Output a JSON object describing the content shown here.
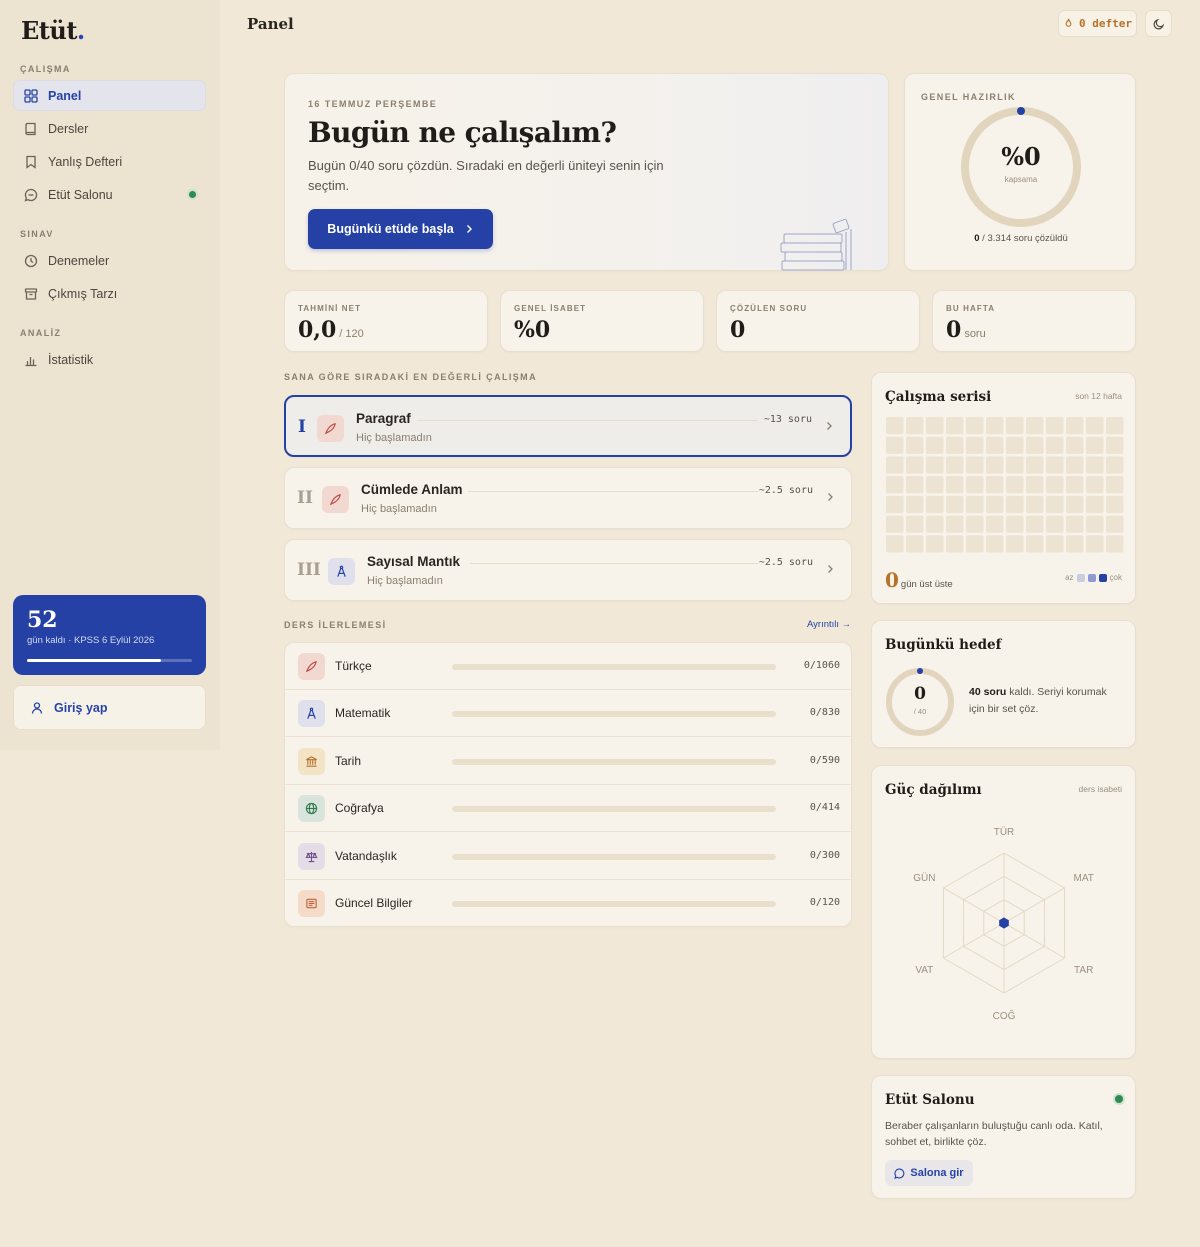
{
  "app": {
    "name": "Etüt",
    "dot": "."
  },
  "sidebar": {
    "sections": [
      {
        "label": "ÇALIŞMA",
        "items": [
          {
            "label": "Panel",
            "icon": "grid-icon",
            "active": true
          },
          {
            "label": "Dersler",
            "icon": "book-icon"
          },
          {
            "label": "Yanlış Defteri",
            "icon": "bookmark-icon"
          },
          {
            "label": "Etüt Salonu",
            "icon": "chat-icon",
            "live": true
          }
        ]
      },
      {
        "label": "SINAV",
        "items": [
          {
            "label": "Denemeler",
            "icon": "clock-icon"
          },
          {
            "label": "Çıkmış Tarzı",
            "icon": "archive-icon"
          }
        ]
      },
      {
        "label": "ANALİZ",
        "items": [
          {
            "label": "İstatistik",
            "icon": "bar-chart-icon"
          }
        ]
      }
    ],
    "countdown": {
      "days": "52",
      "text": "gün kaldı · KPSS 6 Eylül 2026",
      "progress": 0.81
    },
    "login": "Giriş yap"
  },
  "header": {
    "title": "Panel",
    "defter": "0 defter"
  },
  "hero": {
    "date": "16 TEMMUZ PERŞEMBE",
    "headline": "Bugün ne çalışalım?",
    "description": "Bugün 0/40 soru çözdün. Sıradaki en değerli üniteyi senin için seçtim.",
    "cta": "Bugünkü etüde başla"
  },
  "readiness": {
    "label": "GENEL HAZIRLIK",
    "value": "%0",
    "caption": "kapsama",
    "solved": "0",
    "total_text": " / 3.314 soru çözüldü",
    "fraction": 0
  },
  "stats": [
    {
      "label": "TAHMİNİ NET",
      "value": "0,0",
      "unit": "/ 120"
    },
    {
      "label": "GENEL İSABET",
      "value": "%0",
      "unit": ""
    },
    {
      "label": "ÇÖZÜLEN SORU",
      "value": "0",
      "unit": ""
    },
    {
      "label": "BU HAFTA",
      "value": "0",
      "unit": "soru"
    }
  ],
  "next_study": {
    "label": "SANA GÖRE SIRADAKİ EN DEĞERLİ ÇALIŞMA",
    "items": [
      {
        "roman": "I",
        "name": "Paragraf",
        "state": "Hiç başlamadın",
        "count": "~13 soru",
        "icon": "quill-icon",
        "active": true
      },
      {
        "roman": "II",
        "name": "Cümlede Anlam",
        "state": "Hiç başlamadın",
        "count": "~2.5 soru",
        "icon": "quill-icon"
      },
      {
        "roman": "III",
        "name": "Sayısal Mantık",
        "state": "Hiç başlamadın",
        "count": "~2.5 soru",
        "icon": "compass-icon"
      }
    ]
  },
  "progress": {
    "label": "DERS İLERLEMESİ",
    "link": "Ayrıntılı →",
    "rows": [
      {
        "name": "Türkçe",
        "count": "0/1060",
        "fraction": 0,
        "icon": "quill-icon"
      },
      {
        "name": "Matematik",
        "count": "0/830",
        "fraction": 0,
        "icon": "compass-icon"
      },
      {
        "name": "Tarih",
        "count": "0/590",
        "fraction": 0,
        "icon": "museum-icon"
      },
      {
        "name": "Coğrafya",
        "count": "0/414",
        "fraction": 0,
        "icon": "globe-icon"
      },
      {
        "name": "Vatandaşlık",
        "count": "0/300",
        "fraction": 0,
        "icon": "scales-icon"
      },
      {
        "name": "Güncel Bilgiler",
        "count": "0/120",
        "fraction": 0,
        "icon": "newspaper-icon"
      }
    ]
  },
  "streak": {
    "title": "Çalışma serisi",
    "subtitle": "son 12 hafta",
    "count": "0",
    "count_label": "gün üst üste",
    "legend_low": "az",
    "legend_high": "çok",
    "colors": [
      "#ece3d3",
      "#c9cde2",
      "#8e9ad0",
      "#2641a6"
    ]
  },
  "goal": {
    "title": "Bugünkü hedef",
    "value": "0",
    "of": "/ 40",
    "remaining": "40 soru",
    "text": " kaldı. Seriyi korumak için bir set çöz.",
    "fraction": 0
  },
  "power": {
    "title": "Güç dağılımı",
    "subtitle": "ders isabeti",
    "axes": [
      "TÜR",
      "MAT",
      "TAR",
      "COĞ",
      "VAT",
      "GÜN"
    ],
    "values": [
      0,
      0,
      0,
      0,
      0,
      0
    ]
  },
  "salon": {
    "title": "Etüt Salonu",
    "description": "Beraber çalışanların buluştuğu canlı oda. Katıl, sohbet et, birlikte çöz.",
    "button": "Salona gir"
  },
  "colors": {
    "accent": "#2641a6",
    "warm": "#b5732a",
    "live": "#2f8a55"
  }
}
